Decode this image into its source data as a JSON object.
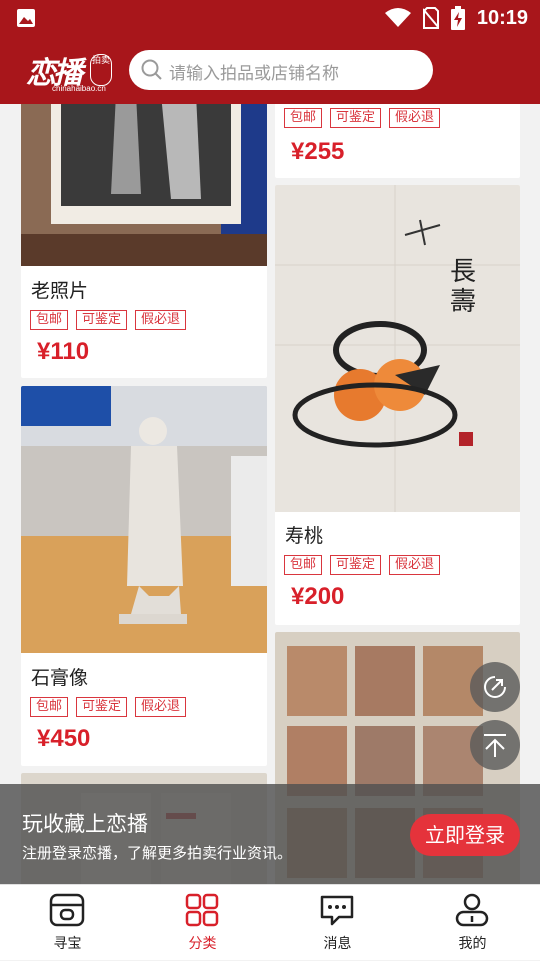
{
  "status_bar": {
    "time": "10:19"
  },
  "header": {
    "logo": {
      "name": "恋播",
      "seal": "拍卖",
      "domain": "chinahaibao.cn"
    },
    "search": {
      "placeholder": "请输入拍品或店铺名称"
    }
  },
  "tag_labels": [
    "包邮",
    "可鉴定",
    "假必退"
  ],
  "products": [
    {
      "title": "",
      "price": "¥255",
      "tags": [
        "包邮",
        "可鉴定",
        "假必退"
      ]
    },
    {
      "title": "老照片",
      "price": "¥110",
      "tags": [
        "包邮",
        "可鉴定",
        "假必退"
      ]
    },
    {
      "title": "寿桃",
      "price": "¥200",
      "tags": [
        "包邮",
        "可鉴定",
        "假必退"
      ]
    },
    {
      "title": "石膏像",
      "price": "¥450",
      "tags": [
        "包邮",
        "可鉴定",
        "假必退"
      ]
    }
  ],
  "promo": {
    "title": "玩收藏上恋播",
    "subtitle": "注册登录恋播，了解更多拍卖行业资讯。",
    "button": "立即登录"
  },
  "tabs": [
    {
      "label": "寻宝",
      "icon": "treasure-icon",
      "active": false
    },
    {
      "label": "分类",
      "icon": "category-grid-icon",
      "active": true
    },
    {
      "label": "消息",
      "icon": "message-icon",
      "active": false
    },
    {
      "label": "我的",
      "icon": "profile-icon",
      "active": false
    }
  ],
  "colors": {
    "brand": "#a8161b",
    "accent": "#d8202a",
    "tag": "#d9363e"
  }
}
